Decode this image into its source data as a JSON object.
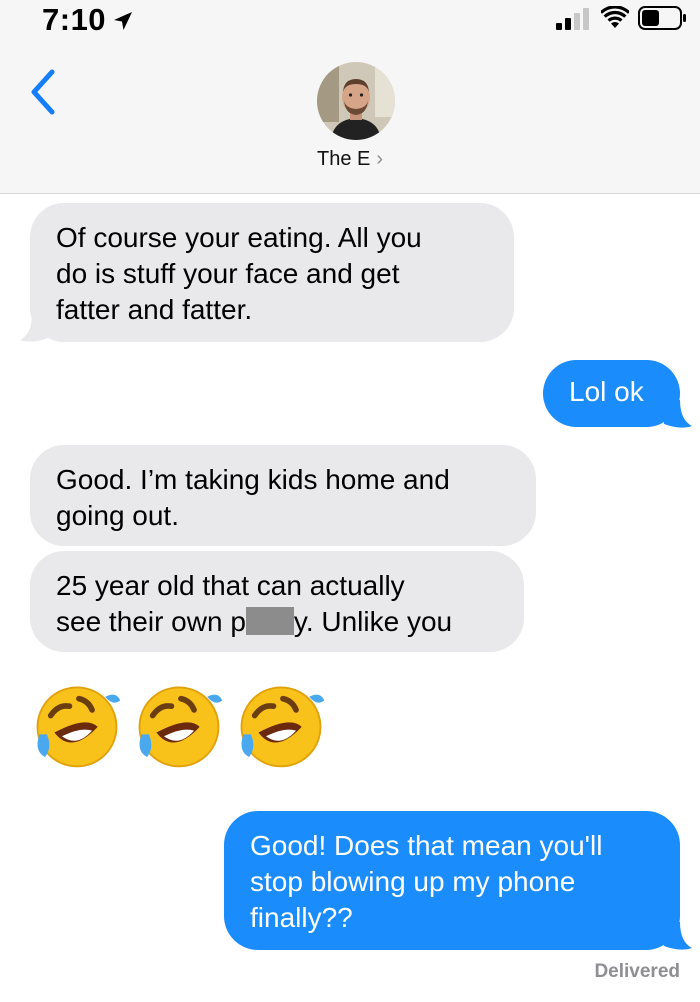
{
  "status_bar": {
    "time": "7:10"
  },
  "header": {
    "contact_name": "The E",
    "chevron": "›"
  },
  "messages": [
    {
      "from": "them",
      "text": "Of course your eating.  All you\ndo is stuff your face and get\nfatter and fatter."
    },
    {
      "from": "me",
      "text": "Lol ok"
    },
    {
      "from": "them",
      "text": "Good.  I’m taking kids home and\ngoing out."
    },
    {
      "from": "them",
      "text_before": "25 year old that can actually\nsee their own p",
      "text_after": "y. Unlike you"
    },
    {
      "from": "them",
      "emoji": [
        "🤣",
        "🤣",
        "🤣"
      ]
    },
    {
      "from": "me",
      "text": "Good! Does that mean you'll\nstop blowing up my phone\nfinally??"
    }
  ],
  "delivery_status": "Delivered",
  "colors": {
    "outgoing_bubble": "#1a8cfb",
    "incoming_bubble": "#e9e9eb",
    "back_accent": "#147efb",
    "header_bg": "#f6f6f6"
  },
  "icons": [
    "location-arrow-icon",
    "cellular-signal-icon",
    "wifi-icon",
    "battery-icon",
    "back-chevron-icon",
    "chevron-right-icon",
    "rolling-laughing-emoji"
  ]
}
